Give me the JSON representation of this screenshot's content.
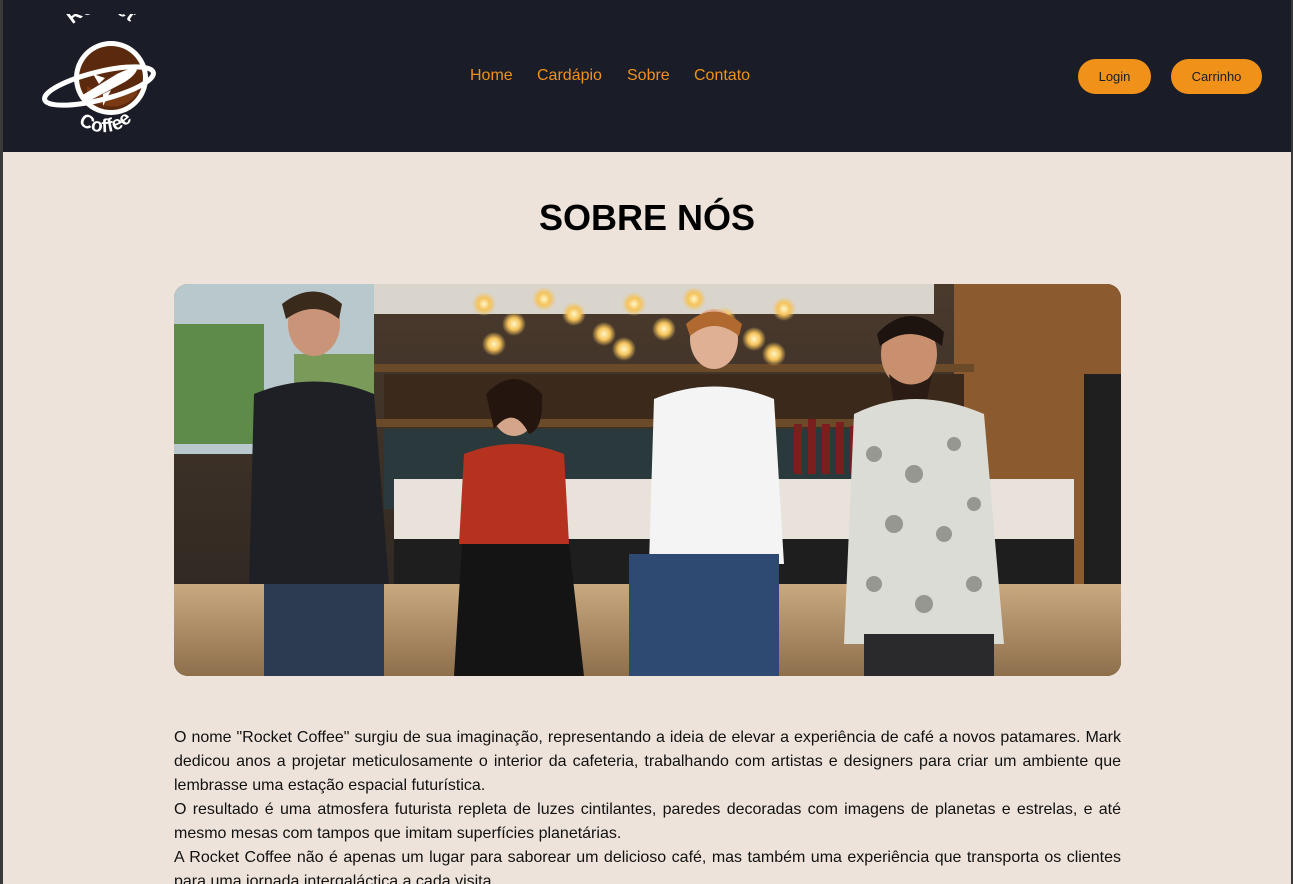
{
  "header": {
    "logo": {
      "line1": "Rocket",
      "line2": "Coffee",
      "icon": "rocket-coffee-logo"
    },
    "nav": {
      "items": [
        {
          "label": "Home"
        },
        {
          "label": "Cardápio"
        },
        {
          "label": "Sobre"
        },
        {
          "label": "Contato"
        }
      ]
    },
    "buttons": {
      "login": "Login",
      "cart": "Carrinho"
    }
  },
  "main": {
    "title": "SOBRE NÓS",
    "paragraphs": [
      "O nome \"Rocket Coffee\" surgiu de sua imaginação, representando a ideia de elevar a experiência de café a novos patamares. Mark dedicou anos a projetar meticulosamente o interior da cafeteria, trabalhando com artistas e designers para criar um ambiente que lembrasse uma estação espacial futurística.",
      "O resultado é uma atmosfera futurista repleta de luzes cintilantes, paredes decoradas com imagens de planetas e estrelas, e até mesmo mesas com tampos que imitam superfícies planetárias.",
      "A Rocket Coffee não é apenas um lugar para saborear um delicioso café, mas também uma experiência que transporta os clientes para uma jornada intergaláctica a cada visita."
    ]
  },
  "colors": {
    "header_bg": "#1a1d28",
    "accent": "#f0921a",
    "page_bg": "#ede3da"
  }
}
